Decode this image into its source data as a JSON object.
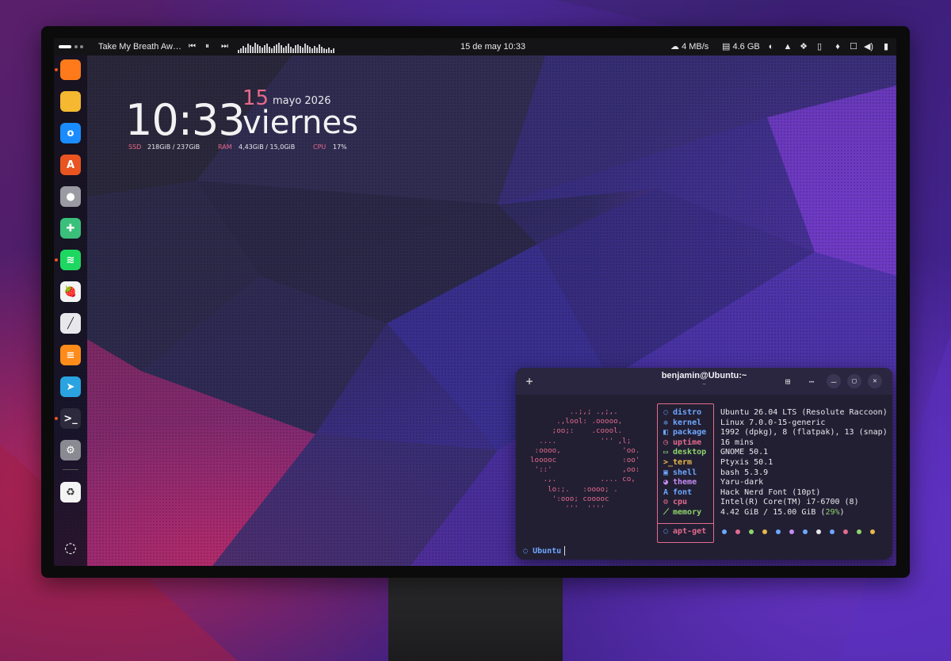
{
  "topbar": {
    "media_title": "Take My Breath Aw…",
    "media_prev": "⏮",
    "media_pause": "⏸",
    "media_next": "⏭",
    "clock": "15 de may  10:33",
    "net_speed": "4 MB/s",
    "memory": "4.6 GB",
    "icons": [
      "cloud-download-icon",
      "memory-chip-icon",
      "theme-icon",
      "drive-icon",
      "dropbox-icon",
      "clipboard-icon",
      "microphone-icon",
      "chat-icon",
      "volume-icon",
      "battery-icon"
    ]
  },
  "dock": {
    "apps": [
      {
        "name": "firefox",
        "glyph": "",
        "color": "#ff7a1a",
        "running": true
      },
      {
        "name": "files",
        "glyph": "",
        "color": "#f5b830",
        "running": false
      },
      {
        "name": "outlook",
        "glyph": "o",
        "color": "#1a8cff",
        "running": false
      },
      {
        "name": "app-center",
        "glyph": "A",
        "color": "#e95420",
        "running": false
      },
      {
        "name": "toggle-app",
        "glyph": "●",
        "color": "#9a9aa2",
        "running": false
      },
      {
        "name": "extensions",
        "glyph": "✚",
        "color": "#3ac07a",
        "running": false
      },
      {
        "name": "spotify",
        "glyph": "≋",
        "color": "#1ed760",
        "running": true
      },
      {
        "name": "raspberry",
        "glyph": "🍓",
        "color": "#f4f4f4",
        "running": false
      },
      {
        "name": "text-editor",
        "glyph": "╱",
        "color": "#e8e8ec",
        "running": false
      },
      {
        "name": "notes",
        "glyph": "≡",
        "color": "#ff8c1a",
        "running": false
      },
      {
        "name": "telegram",
        "glyph": "➤",
        "color": "#2aa3e0",
        "running": false
      },
      {
        "name": "terminal",
        "glyph": ">_",
        "color": "#2c2a3c",
        "running": true
      },
      {
        "name": "settings",
        "glyph": "⚙",
        "color": "#8a8a92",
        "running": false
      },
      {
        "name": "trash",
        "glyph": "♻",
        "color": "#f4f4f4",
        "running": false
      }
    ],
    "show_apps_glyph": "◌"
  },
  "conky": {
    "time": "10:33",
    "day": "15",
    "month_year": "mayo 2026",
    "weekday": "viernes",
    "ssd_label": "SSD",
    "ssd_value": "218GiB / 237GiB",
    "ram_label": "RAM",
    "ram_value": "4,43GiB / 15,0GiB",
    "cpu_label": "CPU",
    "cpu_value": "17%"
  },
  "terminal": {
    "title": "benjamin@Ubuntu:~",
    "subtitle": "~",
    "new_tab": "+",
    "overview_icon": "⊞",
    "menu_icon": "⋯",
    "min_icon": "–",
    "max_icon": "▢",
    "close_icon": "✕",
    "ascii_art": "         ..;,; .,;,.\n      .,lool: .ooooo,\n     ;oo;:    .coool.\n  ....          ''' ,l;\n :oooo,              'oo.\nlooooc               :oo'\n '::'                ,oo:\n   .,.          .... co,\n    lo:;.   :oooo; .\n     ':ooo; cooooc\n        '''  ''''",
    "fields": [
      {
        "key": "distro",
        "icon": "◌",
        "color": "#6ea8ff",
        "value": "Ubuntu 26.04 LTS (Resolute Raccoon)"
      },
      {
        "key": "kernel",
        "icon": "✲",
        "color": "#6ea8ff",
        "value": "Linux 7.0.0-15-generic"
      },
      {
        "key": "package",
        "icon": "◧",
        "color": "#6ea8ff",
        "value": "1992 (dpkg), 8 (flatpak), 13 (snap)"
      },
      {
        "key": "uptime",
        "icon": "◷",
        "color": "#e36b8c",
        "value": "16 mins"
      },
      {
        "key": "desktop",
        "icon": "▭",
        "color": "#8fd46b",
        "value": "GNOME 50.1"
      },
      {
        "key": "term",
        "icon": ">_",
        "color": "#e8b84a",
        "value": "Ptyxis 50.1"
      },
      {
        "key": "shell",
        "icon": "▣",
        "color": "#6ea8ff",
        "value": "bash 5.3.9"
      },
      {
        "key": "theme",
        "icon": "◕",
        "color": "#c58cf0",
        "value": "Yaru-dark"
      },
      {
        "key": "font",
        "icon": "A",
        "color": "#6ea8ff",
        "value": "Hack Nerd Font (10pt)"
      },
      {
        "key": "cpu",
        "icon": "⚙",
        "color": "#e36b8c",
        "value": "Intel(R) Core(TM) i7-6700 (8)"
      },
      {
        "key": "memory",
        "icon": "⟋",
        "color": "#8fd46b",
        "value_main": "4.42 GiB / 15.00 GiB (",
        "value_pct": "29%",
        "value_end": ")"
      }
    ],
    "apt_key": "apt-get",
    "apt_icon": "◌",
    "palette": [
      "#6ea8ff",
      "#e36b8c",
      "#8fd46b",
      "#e8b84a",
      "#6ea8ff",
      "#c58cf0",
      "#6ea8ff",
      "#e8e8ec",
      "#6ea8ff",
      "#e36b8c",
      "#8fd46b",
      "#e8b84a"
    ],
    "prompt": "Ubuntu"
  }
}
